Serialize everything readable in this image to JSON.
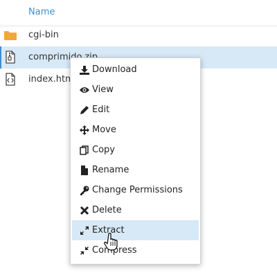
{
  "table": {
    "column_name": "Name"
  },
  "files": [
    {
      "name": "cgi-bin",
      "icon": "folder-icon",
      "color": "#f0a83a"
    },
    {
      "name": "comprimido.zip",
      "icon": "archive-file-icon"
    },
    {
      "name": "index.html",
      "icon": "code-file-icon"
    }
  ],
  "context_menu": {
    "items": [
      {
        "label": "Download",
        "icon": "download-icon"
      },
      {
        "label": "View",
        "icon": "eye-icon"
      },
      {
        "label": "Edit",
        "icon": "pencil-icon"
      },
      {
        "label": "Move",
        "icon": "move-arrows-icon"
      },
      {
        "label": "Copy",
        "icon": "copy-icon"
      },
      {
        "label": "Rename",
        "icon": "file-icon"
      },
      {
        "label": "Change Permissions",
        "icon": "key-icon"
      },
      {
        "label": "Delete",
        "icon": "times-icon"
      },
      {
        "label": "Extract",
        "icon": "expand-icon",
        "active": true
      },
      {
        "label": "Compress",
        "icon": "compress-icon"
      }
    ]
  },
  "colors": {
    "accent": "#3f8fd2",
    "selected_row": "#d7e9f6",
    "folder": "#f0a83a"
  }
}
